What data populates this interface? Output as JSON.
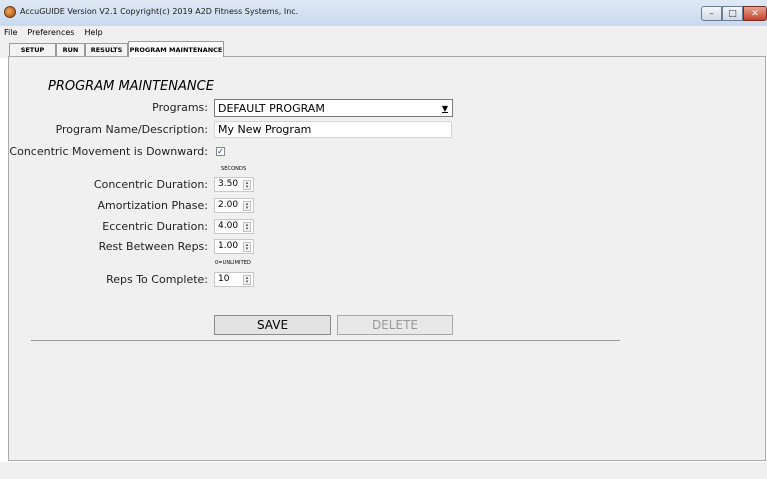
{
  "window": {
    "title": "AccuGUIDE Version V2.1 Copyright(c) 2019 A2D Fitness Systems, Inc.",
    "app_icon": "app-logo-icon",
    "controls": {
      "minimize": "–",
      "maximize": "□",
      "close": "✕"
    }
  },
  "menu": [
    "File",
    "Preferences",
    "Help"
  ],
  "tabs": [
    {
      "label": "SETUP",
      "active": false
    },
    {
      "label": "RUN",
      "active": false
    },
    {
      "label": "RESULTS",
      "active": false
    },
    {
      "label": "PROGRAM MAINTENANCE",
      "active": true
    }
  ],
  "program_maintenance": {
    "section_title": "PROGRAM MAINTENANCE",
    "programs_label": "Programs:",
    "programs_selected": "DEFAULT PROGRAM",
    "name_label": "Program Name/Description:",
    "name_value": "My New Program",
    "concentric_down_label": "Concentric Movement is Downward:",
    "concentric_down_checked": true,
    "checkmark": "✓",
    "seconds_caption": "SECONDS",
    "concentric_duration_label": "Concentric Duration:",
    "concentric_duration_value": "3.50",
    "amortization_label": "Amortization Phase:",
    "amortization_value": "2.00",
    "eccentric_duration_label": "Eccentric Duration:",
    "eccentric_duration_value": "4.00",
    "rest_label": "Rest Between Reps:",
    "rest_value": "1.00",
    "unlimited_caption": "0=UNLIMITED",
    "reps_label": "Reps To Complete:",
    "reps_value": "10",
    "save_label": "SAVE",
    "delete_label": "DELETE",
    "delete_enabled": false
  },
  "colors": {
    "titlebar": "#c9d9ee",
    "panel_bg": "#f0f0f0",
    "disabled_text": "#9a9a9a"
  }
}
